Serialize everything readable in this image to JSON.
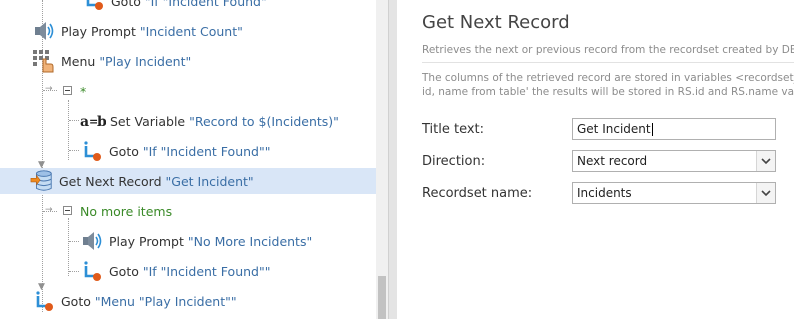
{
  "tree": {
    "top_goto": {
      "keyword": "Goto",
      "target": "\"If \"Incident Found\""
    },
    "play_prompt_count": {
      "keyword": "Play Prompt",
      "target": "\"Incident Count\""
    },
    "menu": {
      "keyword": "Menu",
      "target": "\"Play Incident\""
    },
    "menu_branch_star": "*",
    "set_variable": {
      "keyword": "Set Variable",
      "target": "\"Record to $(Incidents)\""
    },
    "goto_incident_found_1": {
      "keyword": "Goto",
      "target": "\"If \"Incident Found\"\""
    },
    "get_next_record": {
      "keyword": "Get Next Record",
      "target": "\"Get Incident\""
    },
    "no_more_items": "No more items",
    "play_prompt_no_more": {
      "keyword": "Play Prompt",
      "target": "\"No More Incidents\""
    },
    "goto_incident_found_2": {
      "keyword": "Goto",
      "target": "\"If \"Incident Found\"\""
    },
    "goto_menu": {
      "keyword": "Goto",
      "target": "\"Menu \"Play Incident\"\""
    }
  },
  "properties": {
    "title": "Get Next Record",
    "description": "Retrieves the next or previous record from the recordset created by DB E",
    "note_line1": "The columns of the retrieved record are stored in variables <recordset_n",
    "note_line2": "id, name from table' the results will be stored in RS.id and RS.name varia",
    "fields": {
      "title_text": {
        "label": "Title text:",
        "value": "Get Incident"
      },
      "direction": {
        "label": "Direction:",
        "value": "Next record"
      },
      "recordset_name": {
        "label": "Recordset name:",
        "value": "Incidents"
      }
    }
  },
  "colors": {
    "selected_row": "#d9e6f7",
    "string_text": "#3a6ea5",
    "group_text": "#3a8a28"
  },
  "icons": [
    "goto-icon",
    "speaker-icon",
    "keypad-menu-icon",
    "ab-variable-icon",
    "database-icon",
    "chevron-down-icon"
  ]
}
